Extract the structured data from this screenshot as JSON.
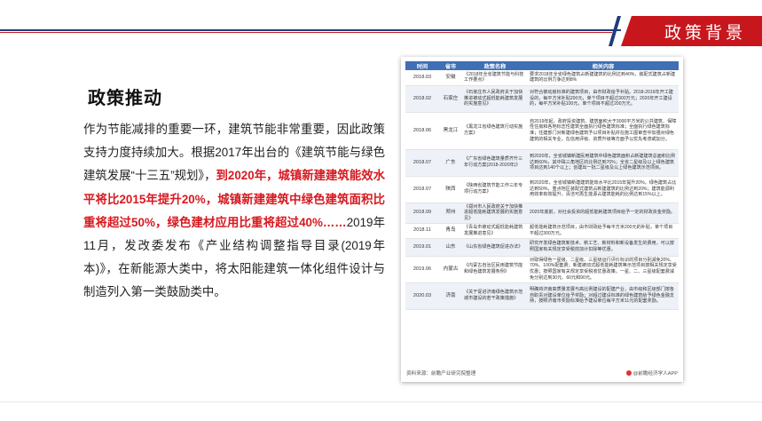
{
  "header": {
    "title": "政策背景"
  },
  "section": {
    "title": "政策推动"
  },
  "body": {
    "p1": "作为节能减排的重要一环，建筑节能非常重要，因此政策支持力度持续加大。根据2017年出台的《建筑节能与绿色建筑发展“十三五”规划》，",
    "p_highlight": "到2020年，城镇新建建筑能效水平将比2015年提升20%，城镇新建建筑中绿色建筑面积比重将超过50%，绿色建材应用比重将超过40%……",
    "p2": "2019年11月，发改委发布《产业结构调整指导目录(2019年本)》，在新能源大类中，将太阳能建筑一体化组件设计与制造列入第一类鼓励类中。"
  },
  "table": {
    "headers": [
      "时间",
      "省市",
      "政策名称",
      "相关内容"
    ],
    "rows": [
      {
        "time": "2018.03",
        "province": "安徽",
        "name": "《2018年全省建筑节能与科技工作要点》",
        "content": "要求2018年全省绿色建筑占新建建筑的比例达到40%，装配式建筑占新建建筑的比例力争达到8%"
      },
      {
        "time": "2018.02",
        "province": "石家庄",
        "name": "《石家庄市人民政府关于加快推进被动式超低能耗建筑发展的实施意见》",
        "content": "对符合被动房标准的建筑项目，由市财政给予补贴。2018-2019年开工建设的，每平方米补贴200元，单个项目不超过300万元；2020年开工建设的，每平方米补贴100元，单个项目不超过200万元。"
      },
      {
        "time": "2018.06",
        "province": "黑龙江",
        "name": "《黑龙江省绿色建筑行动实施方案》",
        "content": "自2019年起，政府投资建筑、建筑面积大于3000平方米的公共建筑、保障性住房和各地标志性建筑全面执行绿色建筑标准；全面执行绿色建筑标准；住建部门对新建绿色建筑予以项目补贴并在施工图审查中加强对绿色建筑的相关专业，在信用评级、资质升级等方面予以优先考虑或加分。"
      },
      {
        "time": "2018.07",
        "province": "广东",
        "name": "《广东省绿色建筑量质齐升三年行动方案(2018-2020年)》",
        "content": "到2020年，全省城镇新建民用建筑中绿色建筑面积占新建建筑总面积比例达到60%，其中珠三角地区的比例达到70%；全省二星级及以上绿色建筑项目达到140个以上；创建出一批二星级及以上绿色建筑示范项目。"
      },
      {
        "time": "2018.07",
        "province": "陕西",
        "name": "《陕西省建筑节能工作三年专项行动方案》",
        "content": "到2020年，全省城镇新建建筑能效水平比2015年提升20%，绿色建筑占比达到50%，重点地区装配式建筑占新建建筑的比例达到20%；建筑能源利用效率有效提升，清洁可再生能源占建筑能耗的比例达到15%以上。"
      },
      {
        "time": "2018.09",
        "province": "郑州",
        "name": "《郑州市人民政府关于加快推进超低能耗建筑发展的实施意见》",
        "content": "2020年底前，对社会投资的超低能耗建筑项目给予一定的财政资金奖励。"
      },
      {
        "time": "2018.11",
        "province": "青岛",
        "name": "《青岛市被动式超低能耗建筑发展推进意见》",
        "content": "超低能耗建筑示范项目，由市财政给予每平方米200元的补贴，单个项目不超过300万元。"
      },
      {
        "time": "2019.01",
        "province": "山东",
        "name": "《山东省绿色建筑促进办法》",
        "content": "研究开发绿色建筑新技术、新工艺、新材料和新设备发生的费用，可以按照国家有关规定享受税前加计扣除等优惠。"
      },
      {
        "time": "2019.06",
        "province": "内蒙古",
        "name": "《内蒙古自治区民用建筑节能和绿色建筑发展条例》",
        "content": "对取得绿色一星级、二星级、三星级运行评价标识的项目分别减免20%、70%、100%配套费；新建被动式超低能耗建筑等示范项目按相关规定享受优惠；按照国家有关规定享受税收优惠政策，一星、二、三星级配套费减免分别达到30元、60元和90元。"
      },
      {
        "time": "2020.03",
        "province": "济南",
        "name": "《关于促进济南绿色建筑示范城市建设的若干政策措施》",
        "content": "明确将济南高质量发展与高比例建设的配建产业，由市级和区级部门按各自职责对建设单位给予奖励；对超过建设标准的绿色建筑给予绿色金融支持，按照济南市奖励标准给予建设单位每平方米11元的配套奖励。"
      }
    ],
    "source": "资料来源：前瞻产业研究院整理",
    "logo": "@前瞻经济学人APP"
  },
  "colors": {
    "accent_red": "#c8161d",
    "accent_blue": "#1f3b7a",
    "table_header": "#3f6fb4",
    "highlight_text": "#d71920"
  }
}
